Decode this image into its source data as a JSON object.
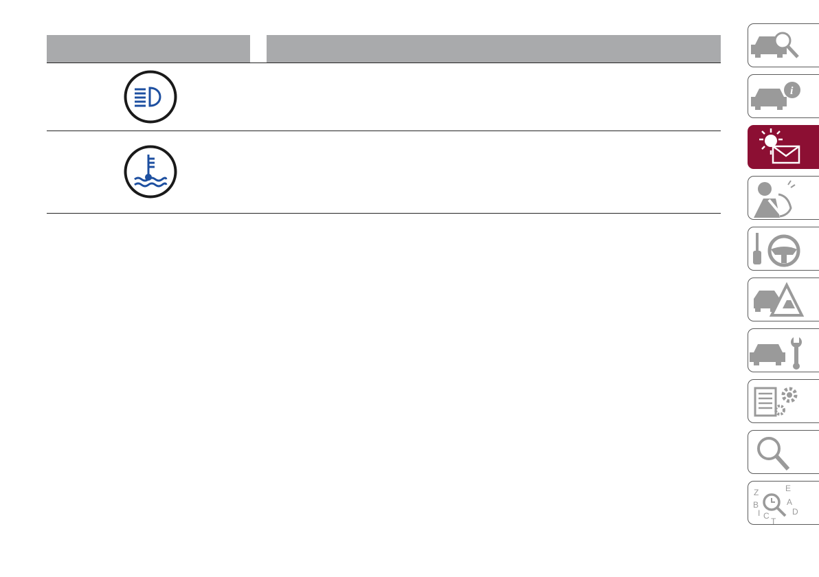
{
  "table": {
    "header": {
      "left": "",
      "right": ""
    },
    "rows": [
      {
        "icon": "high-beam-headlight-icon",
        "text": ""
      },
      {
        "icon": "coolant-temperature-icon",
        "text": ""
      }
    ]
  },
  "side_nav": {
    "active_index": 2,
    "tabs": [
      {
        "icon": "car-search-icon"
      },
      {
        "icon": "car-info-icon"
      },
      {
        "icon": "warning-light-message-icon"
      },
      {
        "icon": "airbag-seatbelt-icon"
      },
      {
        "icon": "key-steering-wheel-icon"
      },
      {
        "icon": "car-hazard-icon"
      },
      {
        "icon": "car-wrench-icon"
      },
      {
        "icon": "specs-gear-icon"
      },
      {
        "icon": "magnifier-icon"
      },
      {
        "icon": "alphabetical-index-icon"
      }
    ]
  },
  "colors": {
    "header_gray": "#a9aaac",
    "icon_blue": "#1d4fa0",
    "active_tab": "#8c0f33",
    "tab_gray": "#9a9a9a"
  }
}
